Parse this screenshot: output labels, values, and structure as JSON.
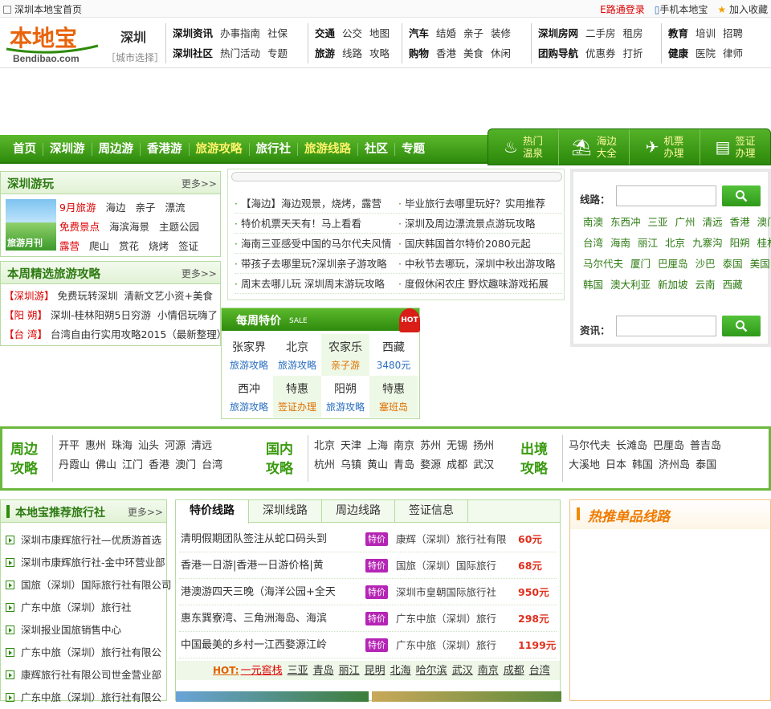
{
  "topbar": {
    "home_link": "深圳本地宝首页",
    "login": "E路通登录",
    "mobile": "手机本地宝",
    "favorite": "加入收藏"
  },
  "header": {
    "logo_cn": "本地宝",
    "logo_en": "Bendibao.com",
    "city": "深圳",
    "city_select": "［城市选择］"
  },
  "nav_groups": [
    {
      "row1": [
        "深圳资讯",
        "办事指南",
        "社保"
      ],
      "row2": [
        "深圳社区",
        "热门活动",
        "专题"
      ],
      "bold": [
        "深圳资讯",
        "深圳社区"
      ]
    },
    {
      "row1": [
        "交通",
        "公交",
        "地图"
      ],
      "row2": [
        "旅游",
        "线路",
        "攻略"
      ],
      "bold": [
        "交通",
        "旅游"
      ]
    },
    {
      "row1": [
        "汽车",
        "结婚",
        "亲子",
        "装修"
      ],
      "row2": [
        "购物",
        "香港",
        "美食",
        "休闲"
      ],
      "bold": [
        "汽车",
        "购物"
      ]
    },
    {
      "row1": [
        "深圳房网",
        "二手房",
        "租房"
      ],
      "row2": [
        "团购导航",
        "优惠券",
        "打折"
      ],
      "bold": [
        "深圳房网",
        "团购导航"
      ]
    },
    {
      "row1": [
        "教育",
        "培训",
        "招聘"
      ],
      "row2": [
        "健康",
        "医院",
        "律师"
      ],
      "bold": [
        "教育",
        "健康"
      ]
    }
  ],
  "main_nav": [
    {
      "label": "首页",
      "hl": false
    },
    {
      "label": "深圳游",
      "hl": false
    },
    {
      "label": "周边游",
      "hl": false
    },
    {
      "label": "香港游",
      "hl": false
    },
    {
      "label": "旅游攻略",
      "hl": true
    },
    {
      "label": "旅行社",
      "hl": false
    },
    {
      "label": "旅游线路",
      "hl": true
    },
    {
      "label": "社区",
      "hl": false
    },
    {
      "label": "专题",
      "hl": false
    }
  ],
  "services": [
    {
      "l1": "热门",
      "l2": "温泉",
      "icon": "hotspring-icon",
      "glyph": "♨"
    },
    {
      "l1": "海边",
      "l2": "大全",
      "icon": "beach-icon",
      "glyph": "⛱"
    },
    {
      "l1": "机票",
      "l2": "办理",
      "icon": "plane-icon",
      "glyph": "✈"
    },
    {
      "l1": "签证",
      "l2": "办理",
      "icon": "visa-icon",
      "glyph": "▤"
    }
  ],
  "sz_play": {
    "title": "深圳游玩",
    "more": "更多>>",
    "thumb_caption": "旅游月刊",
    "rows": [
      [
        {
          "t": "9月旅游",
          "red": true
        },
        {
          "t": "海边"
        },
        {
          "t": "亲子"
        },
        {
          "t": "漂流"
        }
      ],
      [
        {
          "t": "免费景点",
          "red": true
        },
        {
          "t": "海滨海景"
        },
        {
          "t": "主题公园"
        }
      ],
      [
        {
          "t": "露营",
          "red": true
        },
        {
          "t": "爬山"
        },
        {
          "t": "赏花"
        },
        {
          "t": "烧烤"
        },
        {
          "t": "签证"
        }
      ]
    ]
  },
  "weekly": {
    "title": "本周精选旅游攻略",
    "more": "更多>>",
    "rows": [
      {
        "tag": "【深圳游】",
        "a": "免费玩转深圳",
        "b": "清新文艺小资+美食"
      },
      {
        "tag": "【阳 朔】",
        "a": "深圳-桂林阳朔5日穷游",
        "b": "小情侣玩嗨了"
      },
      {
        "tag": "【台 湾】",
        "a": "台湾自由行实用攻略2015（最新整理）",
        "b": ""
      }
    ]
  },
  "news": [
    [
      "【海边】海边观景，烧烤，露营",
      "毕业旅行去哪里玩好？实用推荐"
    ],
    [
      "特价机票天天有！马上看看",
      "深圳及周边漂流景点游玩攻略"
    ],
    [
      "海南三亚感受中国的马尔代夫风情",
      "国庆韩国首尔特价2080元起"
    ],
    [
      "带孩子去哪里玩?深圳亲子游攻略",
      "中秋节去哪玩，深圳中秋出游攻略"
    ],
    [
      "周末去哪儿玩 深圳周末游玩攻略",
      "度假休闲农庄 野炊趣味游戏拓展"
    ]
  ],
  "deals": {
    "title": "每周特价",
    "sale": "SALE",
    "hot": "HOT",
    "cells": [
      {
        "a": "张家界",
        "b": "旅游攻略",
        "bc": "blue",
        "g": false
      },
      {
        "a": "北京",
        "b": "旅游攻略",
        "bc": "blue",
        "g": false
      },
      {
        "a": "农家乐",
        "b": "亲子游",
        "bc": "orange",
        "g": true
      },
      {
        "a": "西藏",
        "b": "3480元",
        "bc": "blue",
        "g": false
      },
      {
        "a": "西冲",
        "b": "旅游攻略",
        "bc": "blue",
        "g": false
      },
      {
        "a": "特惠",
        "b": "签证办理",
        "bc": "orange",
        "g": true
      },
      {
        "a": "阳朔",
        "b": "旅游攻略",
        "bc": "blue",
        "g": false
      },
      {
        "a": "特惠",
        "b": "塞班岛",
        "bc": "orange",
        "g": true
      }
    ]
  },
  "search": {
    "route_label": "线路：",
    "info_label": "资讯：",
    "tags": [
      [
        "南澳",
        "东西冲",
        "三亚",
        "广州",
        "清远",
        "香港",
        "澳门"
      ],
      [
        "台湾",
        "海南",
        "丽江",
        "北京",
        "九寨沟",
        "阳朔",
        "桂林"
      ],
      [
        "马尔代夫",
        "厦门",
        "巴厘岛",
        "沙巴",
        "泰国",
        "美国"
      ],
      [
        "韩国",
        "澳大利亚",
        "新加坡",
        "云南",
        "西藏"
      ]
    ]
  },
  "dest": [
    {
      "label1": "周边",
      "label2": "攻略",
      "row1": [
        "开平",
        "惠州",
        "珠海",
        "汕头",
        "河源",
        "清远"
      ],
      "row2": [
        "丹霞山",
        "佛山",
        "江门",
        "香港",
        "澳门",
        "台湾"
      ]
    },
    {
      "label1": "国内",
      "label2": "攻略",
      "row1": [
        "北京",
        "天津",
        "上海",
        "南京",
        "苏州",
        "无锡",
        "扬州"
      ],
      "row2": [
        "杭州",
        "乌镇",
        "黄山",
        "青岛",
        "婺源",
        "成都",
        "武汉"
      ]
    },
    {
      "label1": "出境",
      "label2": "攻略",
      "row1": [
        "马尔代夫",
        "长滩岛",
        "巴厘岛",
        "普吉岛"
      ],
      "row2": [
        "大溪地",
        "日本",
        "韩国",
        "济州岛",
        "泰国"
      ]
    }
  ],
  "agencies": {
    "title": "本地宝推荐旅行社",
    "more": "更多>>",
    "items": [
      "深圳市康辉旅行社—优质游首选",
      "深圳市康辉旅行社-金中环营业部",
      "国旅（深圳）国际旅行社有限公司",
      "广东中旅（深圳）旅行社",
      "深圳报业国旅销售中心",
      "广东中旅（深圳）旅行社有限公",
      "康辉旅行社有限公司世金营业部",
      "广东中旅（深圳）旅行社有限公"
    ]
  },
  "routes": {
    "tabs": [
      "特价线路",
      "深圳线路",
      "周边线路",
      "签证信息"
    ],
    "tag": "特价",
    "items": [
      {
        "n": "清明假期团队签注从蛇口码头到",
        "ag": "康辉（深圳）旅行社有限",
        "p": "60元"
      },
      {
        "n": "香港一日游|香港一日游价格|黄",
        "ag": "国旅（深圳）国际旅行",
        "p": "68元"
      },
      {
        "n": "港澳游四天三晚（海洋公园+全天",
        "ag": "深圳市皇朝国际旅行社",
        "p": "950元"
      },
      {
        "n": "惠东巽寮湾、三角洲海岛、海滨",
        "ag": "广东中旅（深圳）旅行",
        "p": "298元"
      },
      {
        "n": "中国最美的乡村一江西婺源江岭",
        "ag": "广东中旅（深圳）旅行",
        "p": "1199元"
      }
    ],
    "hot_label": "HOT:",
    "hot_links": [
      "一元窖栈",
      "三亚",
      "青岛",
      "丽江",
      "昆明",
      "北海",
      "哈尔滨",
      "武汉",
      "南京",
      "成都",
      "台湾"
    ]
  },
  "hotlines": {
    "title": "热推单品线路"
  }
}
